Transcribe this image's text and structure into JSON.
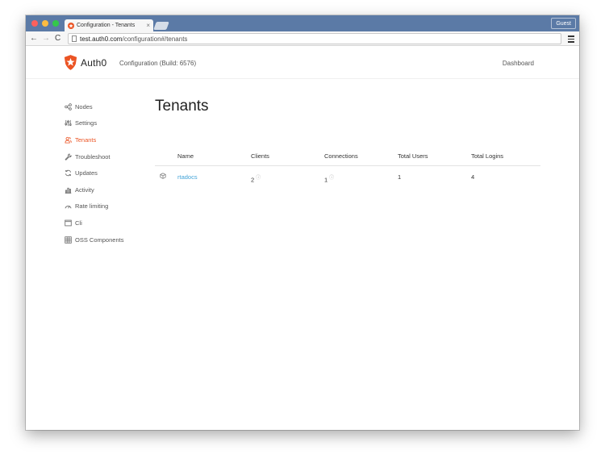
{
  "browser": {
    "tab_title": "Configuration - Tenants",
    "tab_close": "×",
    "profile": "Guest",
    "url_host": "test.auth0.com",
    "url_path": "/configuration#/tenants",
    "back": "←",
    "forward": "→",
    "reload": "C"
  },
  "header": {
    "logo_text": "Auth0",
    "build": "Configuration (Build: 6576)",
    "dashboard_link": "Dashboard",
    "brand_color": "#eb5424"
  },
  "sidebar": {
    "items": [
      {
        "label": "Nodes",
        "icon": "nodes-icon"
      },
      {
        "label": "Settings",
        "icon": "settings-icon"
      },
      {
        "label": "Tenants",
        "icon": "tenants-icon",
        "active": true
      },
      {
        "label": "Troubleshoot",
        "icon": "wrench-icon"
      },
      {
        "label": "Updates",
        "icon": "refresh-icon"
      },
      {
        "label": "Activity",
        "icon": "bar-chart-icon"
      },
      {
        "label": "Rate limiting",
        "icon": "gauge-icon"
      },
      {
        "label": "Cli",
        "icon": "terminal-icon"
      },
      {
        "label": "OSS Components",
        "icon": "grid-icon"
      }
    ]
  },
  "main": {
    "title": "Tenants",
    "table": {
      "headers": [
        "Name",
        "Clients",
        "Connections",
        "Total Users",
        "Total Logins"
      ],
      "rows": [
        {
          "name": "rtadocs",
          "clients": "2",
          "connections": "1",
          "total_users": "1",
          "total_logins": "4"
        }
      ]
    },
    "info_glyph": "ⓘ"
  }
}
